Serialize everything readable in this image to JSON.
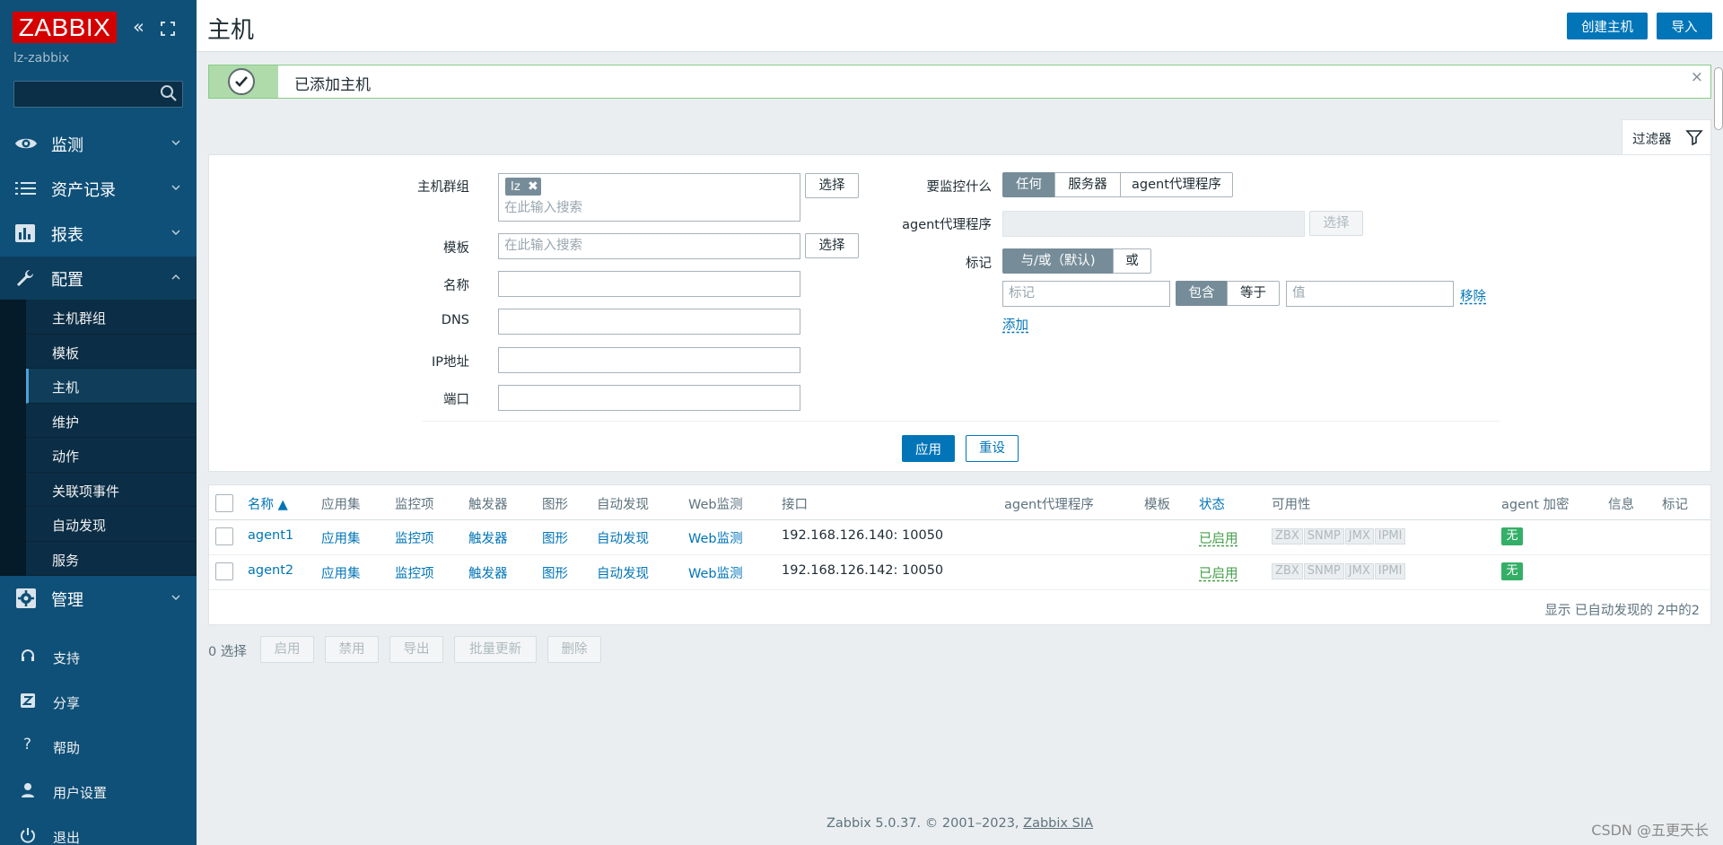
{
  "sidebar": {
    "logo": "ZABBIX",
    "server_name": "lz-zabbix",
    "menu": [
      {
        "label": "监测",
        "icon": "eye-icon"
      },
      {
        "label": "资产记录",
        "icon": "list-icon"
      },
      {
        "label": "报表",
        "icon": "bar-chart-icon"
      },
      {
        "label": "配置",
        "icon": "wrench-icon"
      },
      {
        "label": "管理",
        "icon": "gear-icon"
      }
    ],
    "submenu": [
      "主机群组",
      "模板",
      "主机",
      "维护",
      "动作",
      "关联项事件",
      "自动发现",
      "服务"
    ],
    "active_submenu": "主机",
    "utility": [
      {
        "label": "支持",
        "icon": "headset-icon"
      },
      {
        "label": "分享",
        "icon": "share-icon"
      },
      {
        "label": "帮助",
        "icon": "help-icon"
      },
      {
        "label": "用户设置",
        "icon": "user-icon"
      },
      {
        "label": "退出",
        "icon": "power-icon"
      }
    ]
  },
  "header": {
    "title": "主机",
    "create_button": "创建主机",
    "import_button": "导入"
  },
  "message": {
    "text": "已添加主机",
    "close": "×"
  },
  "filter": {
    "tab_label": "过滤器",
    "host_group_label": "主机群组",
    "host_group_chip": "lz",
    "search_placeholder": "在此输入搜索",
    "select_button": "选择",
    "template_label": "模板",
    "name_label": "名称",
    "dns_label": "DNS",
    "ip_label": "IP地址",
    "port_label": "端口",
    "monitored_by_label": "要监控什么",
    "monitored_by_options": [
      "任何",
      "服务器",
      "agent代理程序"
    ],
    "monitored_by_selected": "任何",
    "proxy_label": "agent代理程序",
    "tags_label": "标记",
    "tags_op_options": [
      "与/或（默认)",
      "或"
    ],
    "tag_placeholder": "标记",
    "tag_match_options": [
      "包含",
      "等于"
    ],
    "value_placeholder": "值",
    "remove_link": "移除",
    "add_link": "添加",
    "apply_button": "应用",
    "reset_button": "重设"
  },
  "table": {
    "columns": [
      "名称 ▲",
      "应用集",
      "监控项",
      "触发器",
      "图形",
      "自动发现",
      "Web监测",
      "接口",
      "agent代理程序",
      "模板",
      "状态",
      "可用性",
      "agent 加密",
      "信息",
      "标记"
    ],
    "rows": [
      {
        "name": "agent1",
        "apps": "应用集",
        "items": "监控项",
        "triggers": "触发器",
        "graphs": "图形",
        "discovery": "自动发现",
        "web": "Web监测",
        "interface": "192.168.126.140: 10050",
        "status": "已启用",
        "availability": [
          "ZBX",
          "SNMP",
          "JMX",
          "IPMI"
        ],
        "encryption": "无"
      },
      {
        "name": "agent2",
        "apps": "应用集",
        "items": "监控项",
        "triggers": "触发器",
        "graphs": "图形",
        "discovery": "自动发现",
        "web": "Web监测",
        "interface": "192.168.126.142: 10050",
        "status": "已启用",
        "availability": [
          "ZBX",
          "SNMP",
          "JMX",
          "IPMI"
        ],
        "encryption": "无"
      }
    ],
    "footer": "显示 已自动发现的 2中的2"
  },
  "actions": {
    "selected": "0 选择",
    "buttons": [
      "启用",
      "禁用",
      "导出",
      "批量更新",
      "删除"
    ]
  },
  "footer": {
    "text": "Zabbix 5.0.37. © 2001–2023, ",
    "link": "Zabbix SIA"
  },
  "watermark": "CSDN @五更天长",
  "colors": {
    "sidebar": "#0f5078",
    "logo_red": "#d40000",
    "primary": "#0275b8",
    "success": "#429e47"
  }
}
